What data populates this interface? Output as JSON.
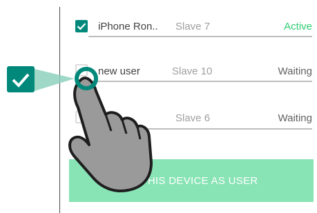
{
  "devices": [
    {
      "name": "iPhone Ron..",
      "slave": "Slave 7",
      "status": "Active",
      "checked": true,
      "status_color": "#2ecc71"
    },
    {
      "name": "new user",
      "slave": "Slave 10",
      "status": "Waiting",
      "checked": false,
      "status_color": "#616161"
    },
    {
      "name": "",
      "slave": "Slave 6",
      "status": "Waiting",
      "checked": false,
      "status_color": "#616161"
    }
  ],
  "cta": {
    "label": "TE THIS DEVICE AS USER"
  },
  "colors": {
    "accent": "#00897b",
    "cta_background": "#88e3b5",
    "active": "#2ecc71"
  },
  "overlay": {
    "gesture": "tap-hand-icon",
    "callout": "checkbox-checked-icon"
  }
}
